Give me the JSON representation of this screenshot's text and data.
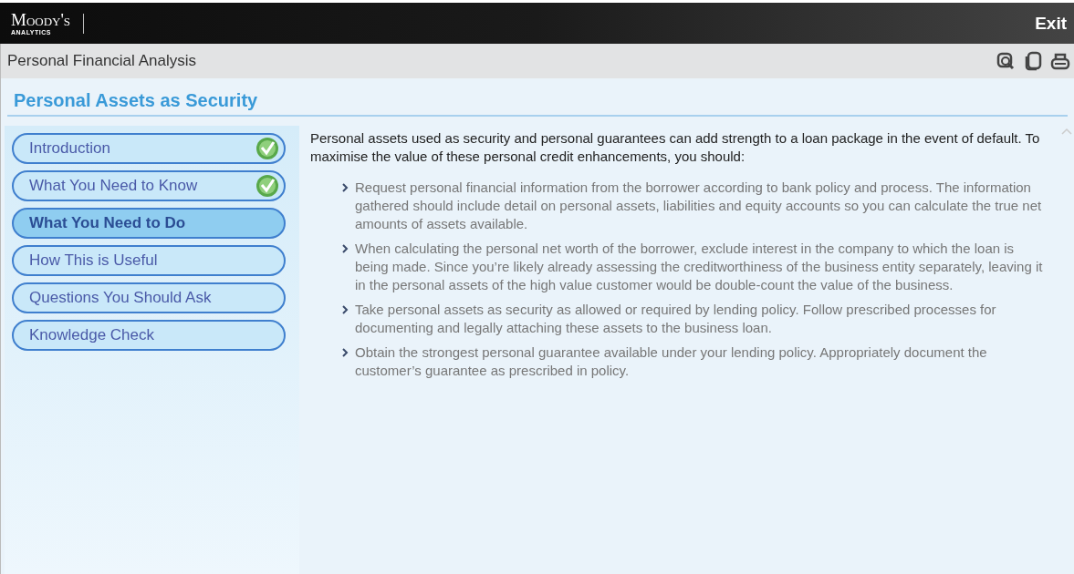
{
  "header": {
    "logo_name": "Moody's",
    "logo_sub": "ANALYTICS",
    "exit": "Exit"
  },
  "toolbar": {
    "title": "Personal Financial Analysis"
  },
  "page": {
    "heading": "Personal Assets as Security"
  },
  "nav": [
    {
      "label": "Introduction",
      "completed": true,
      "selected": false
    },
    {
      "label": "What You Need to Know",
      "completed": true,
      "selected": false
    },
    {
      "label": "What You Need to Do",
      "completed": false,
      "selected": true
    },
    {
      "label": "How This is Useful",
      "completed": false,
      "selected": false
    },
    {
      "label": "Questions You Should Ask",
      "completed": false,
      "selected": false
    },
    {
      "label": "Knowledge Check",
      "completed": false,
      "selected": false
    }
  ],
  "content": {
    "intro": "Personal assets used as security and personal guarantees can add strength to a loan package in the event of default. To maximise the value of these personal credit enhancements, you should:",
    "bullets": [
      "Request personal financial information from the borrower according to bank policy and process. The information gathered should include detail on personal assets, liabilities and equity accounts so you can calculate the true net amounts of assets available.",
      "When calculating the personal net worth of the borrower, exclude interest in the company to which the loan is being made. Since you’re likely already assessing the creditworthiness of the business entity separately, leaving it in the personal assets of the high value customer would be double-count the value of the business.",
      "Take personal assets as security as allowed or required by lending policy. Follow prescribed processes for documenting and legally attaching these assets to the business loan.",
      "Obtain the strongest personal guarantee available under your lending policy. Appropriately document the customer’s guarantee as prescribed in policy."
    ]
  }
}
